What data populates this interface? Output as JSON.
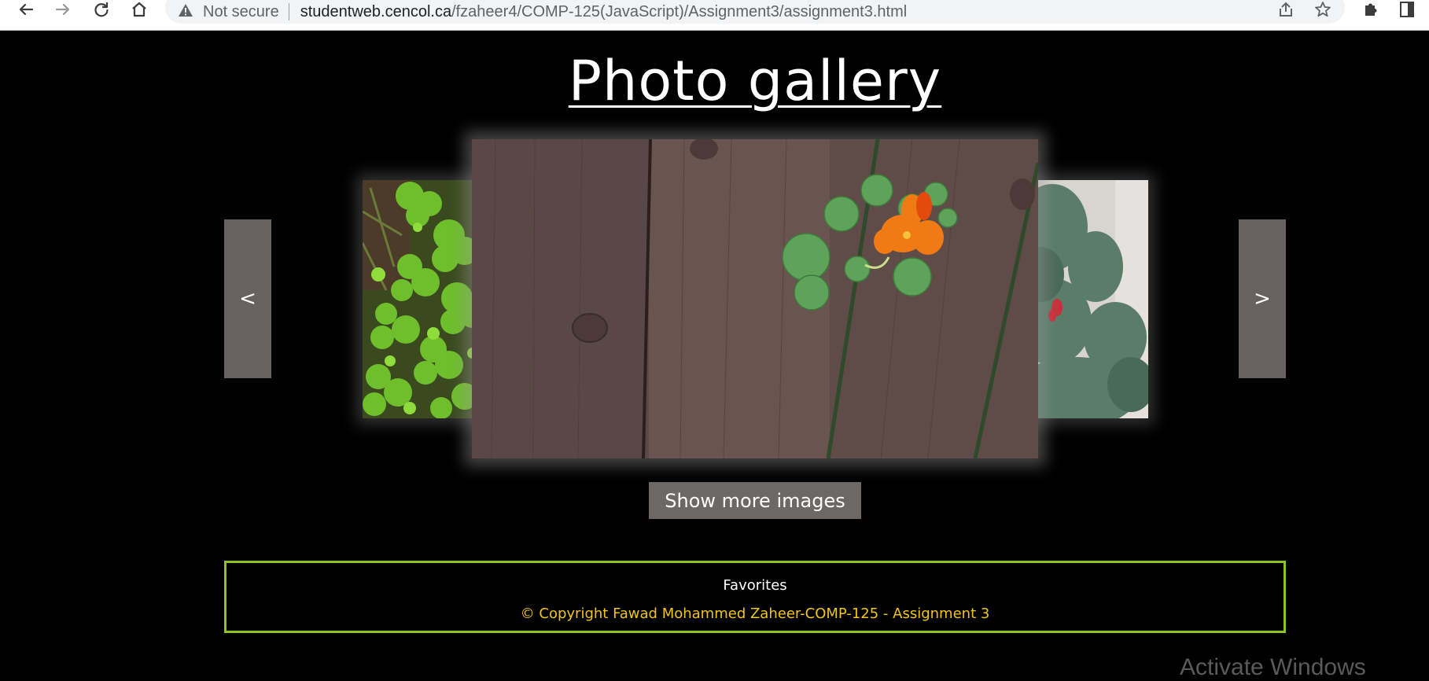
{
  "browser": {
    "security_label": "Not secure",
    "url_host": "studentweb.cencol.ca",
    "url_path": "/fzaheer4/COMP-125(JavaScript)/Assignment3/assignment3.html"
  },
  "gallery": {
    "title": "Photo gallery",
    "prev_label": "<",
    "next_label": ">",
    "more_button_label": "Show more images"
  },
  "footer": {
    "title": "Favorites",
    "copyright": "© Copyright Fawad Mohammed Zaheer-COMP-125 - Assignment 3"
  },
  "watermark": "Activate Windows",
  "colors": {
    "background": "#000000",
    "button_gray": "#67615f",
    "footer_border": "#8fc31f",
    "copyright_text": "#f0c419"
  }
}
